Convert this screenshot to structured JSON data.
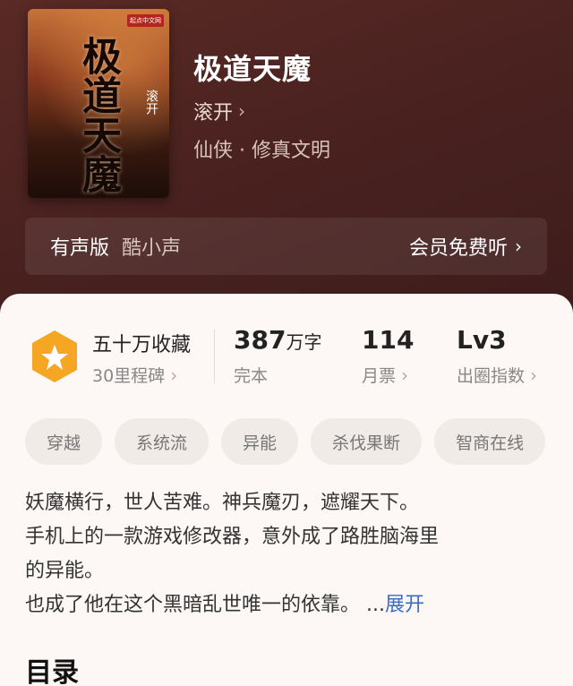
{
  "book": {
    "title": "极道天魔",
    "author": "滚开",
    "genre": "仙侠 · 修真文明",
    "cover": {
      "publisher": "起点中文网",
      "title_text": "极道天魔",
      "author_text": "滚开"
    }
  },
  "audio": {
    "label": "有声版",
    "reader": "酷小声",
    "free_listen": "会员免费听"
  },
  "stats": {
    "collection": {
      "main": "五十万收藏",
      "sub": "30里程碑"
    },
    "words": {
      "number": "387",
      "unit": "万字",
      "sub": "完本"
    },
    "monthly_votes": {
      "number": "114",
      "sub": "月票"
    },
    "popularity": {
      "number": "Lv3",
      "sub": "出圈指数"
    }
  },
  "tags": [
    "穿越",
    "系统流",
    "异能",
    "杀伐果断",
    "智商在线"
  ],
  "description": {
    "line1": "妖魔横行，世人苦难。神兵魔刃，遮耀天下。",
    "line2": "手机上的一款游戏修改器，意外成了路胜脑海里",
    "line3": "的异能。",
    "line4": "也成了他在这个黑暗乱世唯一的依靠。 ...",
    "expand": "展开"
  },
  "toc_label": "目录",
  "colors": {
    "hero_bg": "#4a2220",
    "badge": "#f5a623",
    "link": "#3a6dc2"
  }
}
